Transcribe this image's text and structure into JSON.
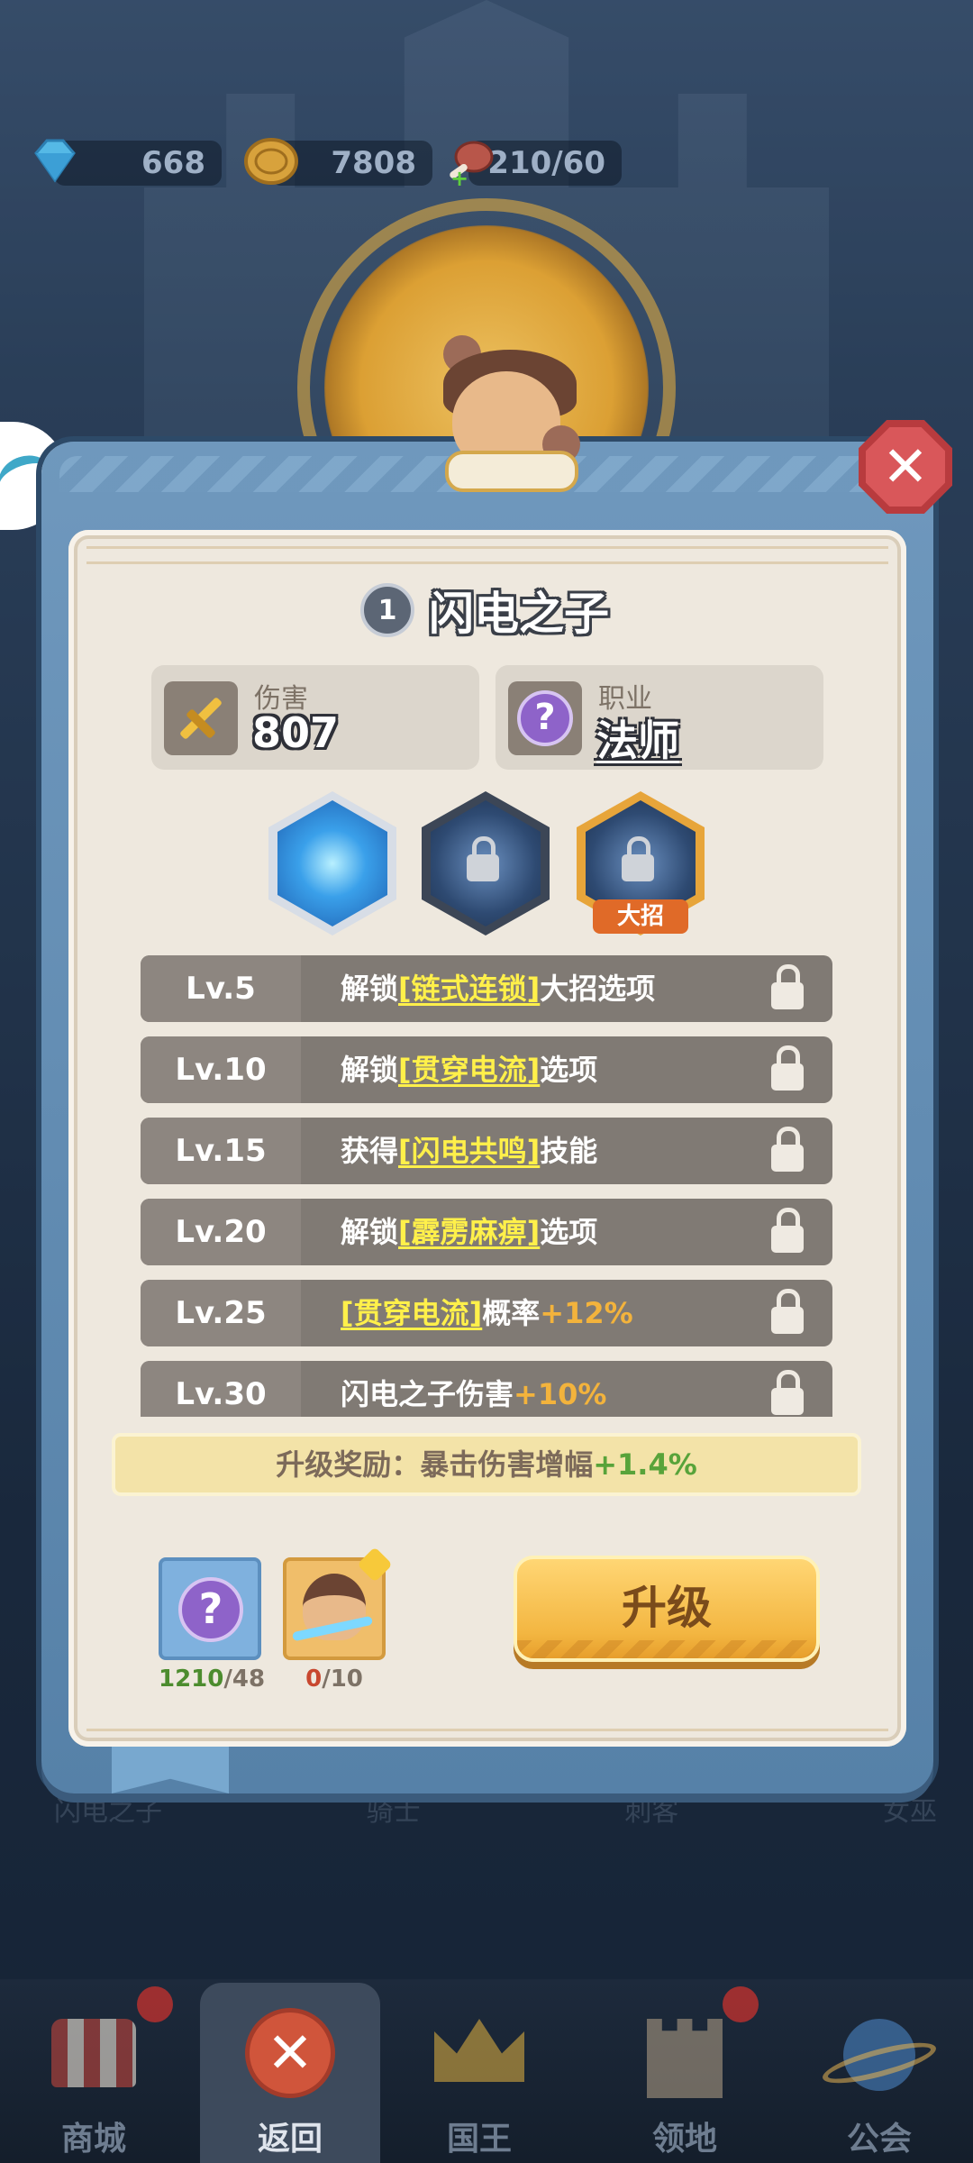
{
  "resources": {
    "gems": "668",
    "gold": "7808",
    "stamina": "210/60"
  },
  "hero": {
    "level": "1",
    "name": "闪电之子",
    "damage_label": "伤害",
    "damage_value": "807",
    "class_label": "职业",
    "class_value": "法师"
  },
  "skills": {
    "ult_tag": "大招"
  },
  "level_rewards": [
    {
      "lv": "Lv.5",
      "pre": "解锁",
      "highlight": "[链式连锁]",
      "post": "大招选项",
      "bonus": ""
    },
    {
      "lv": "Lv.10",
      "pre": "解锁",
      "highlight": "[贯穿电流]",
      "post": "选项",
      "bonus": ""
    },
    {
      "lv": "Lv.15",
      "pre": "获得",
      "highlight": "[闪电共鸣]",
      "post": "技能",
      "bonus": ""
    },
    {
      "lv": "Lv.20",
      "pre": "解锁",
      "highlight": "[霹雳麻痹]",
      "post": "选项",
      "bonus": ""
    },
    {
      "lv": "Lv.25",
      "pre": "",
      "highlight": "[贯穿电流]",
      "post": "概率",
      "bonus": "+12%"
    },
    {
      "lv": "Lv.30",
      "pre": "闪电之子伤害",
      "highlight": "",
      "post": "",
      "bonus": "+10%"
    }
  ],
  "upgrade_reward": {
    "label": "升级奖励：暴击伤害增幅",
    "value": "+1.4%"
  },
  "materials": {
    "class_token_have": "1210",
    "class_token_need": "/48",
    "hero_shard_have": "0",
    "hero_shard_need": "/10"
  },
  "upgrade_button": "升级",
  "background_tabs": [
    "闪电之子",
    "骑士",
    "刺客",
    "女巫"
  ],
  "bottom_nav": {
    "shop": "商城",
    "back": "返回",
    "king": "国王",
    "territory": "领地",
    "guild": "公会"
  },
  "colors": {
    "highlight_yellow": "#fff04a",
    "bonus_orange": "#f3b33c",
    "reward_green": "#58a33a",
    "button_gold": "#f3b641",
    "close_red": "#d9575a"
  }
}
